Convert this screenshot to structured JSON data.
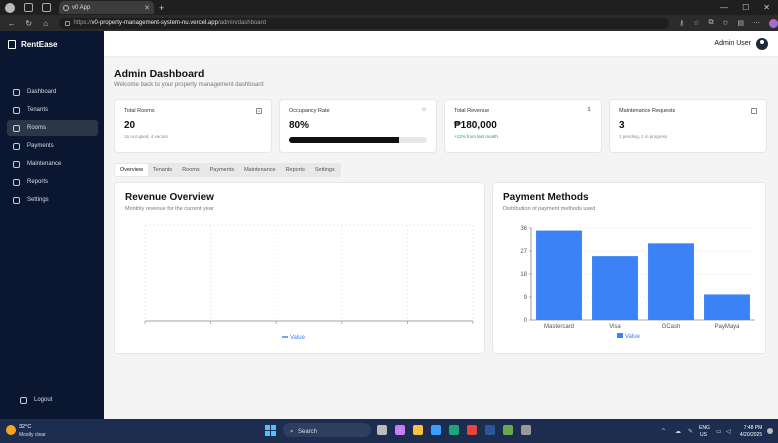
{
  "browser": {
    "tab_title": "v0 App",
    "url_prefix": "https://",
    "url_host": "v0-property-management-system-nu.vercel.app",
    "url_path": "/admin/dashboard"
  },
  "sidebar": {
    "brand": "RentEase",
    "items": [
      {
        "label": "Dashboard",
        "icon": "dashboard-icon",
        "active": false
      },
      {
        "label": "Tenants",
        "icon": "users-icon",
        "active": false
      },
      {
        "label": "Rooms",
        "icon": "door-icon",
        "active": true
      },
      {
        "label": "Payments",
        "icon": "card-icon",
        "active": false
      },
      {
        "label": "Maintenance",
        "icon": "wrench-icon",
        "active": false
      },
      {
        "label": "Reports",
        "icon": "document-icon",
        "active": false
      },
      {
        "label": "Settings",
        "icon": "gear-icon",
        "active": false
      }
    ],
    "logout": "Logout"
  },
  "header": {
    "user_name": "Admin User"
  },
  "page": {
    "title": "Admin Dashboard",
    "subtitle": "Welcome back to your property management dashboard"
  },
  "cards": [
    {
      "title": "Total Rooms",
      "value": "20",
      "sub": "16 occupied, 4 vacant",
      "icon": "home-icon"
    },
    {
      "title": "Occupancy Rate",
      "value": "80%",
      "progress": 0.8,
      "icon": "users-icon"
    },
    {
      "title": "Total Revenue",
      "value": "₱180,000",
      "sub": "+12% from last month",
      "icon": "dollar-icon"
    },
    {
      "title": "Maintenance Requests",
      "value": "3",
      "sub": "1 pending, 1 in progress",
      "icon": "message-icon"
    }
  ],
  "tabs": [
    "Overview",
    "Tenants",
    "Rooms",
    "Payments",
    "Maintenance",
    "Reports",
    "Settings"
  ],
  "active_tab": "Overview",
  "revenue": {
    "title": "Revenue Overview",
    "subtitle": "Monthly revenue for the current year",
    "legend": "Value"
  },
  "payment": {
    "title": "Payment Methods",
    "subtitle": "Distribution of payment methods used",
    "legend": "Value"
  },
  "colors": {
    "sidebar": "#0b1730",
    "bar": "#3b82f6"
  },
  "chart_data": [
    {
      "type": "line",
      "title": "Revenue Overview",
      "subtitle": "Monthly revenue for the current year",
      "series": [
        {
          "name": "Value",
          "values": []
        }
      ],
      "grid": true,
      "legend": "bottom"
    },
    {
      "type": "bar",
      "title": "Payment Methods",
      "subtitle": "Distribution of payment methods used",
      "categories": [
        "Mastercard",
        "Visa",
        "GCash",
        "PayMaya"
      ],
      "values": [
        35,
        25,
        30,
        10
      ],
      "yticks": [
        0,
        9,
        18,
        27,
        36
      ],
      "ylim": [
        0,
        36
      ],
      "grid": true,
      "legend": "bottom",
      "series_name": "Value"
    }
  ],
  "taskbar": {
    "weather_temp": "32°C",
    "weather_desc": "Mostly clear",
    "search": "Search",
    "lang": "ENG",
    "region": "US",
    "time": "7:48 PM",
    "date": "4/20/2025"
  }
}
